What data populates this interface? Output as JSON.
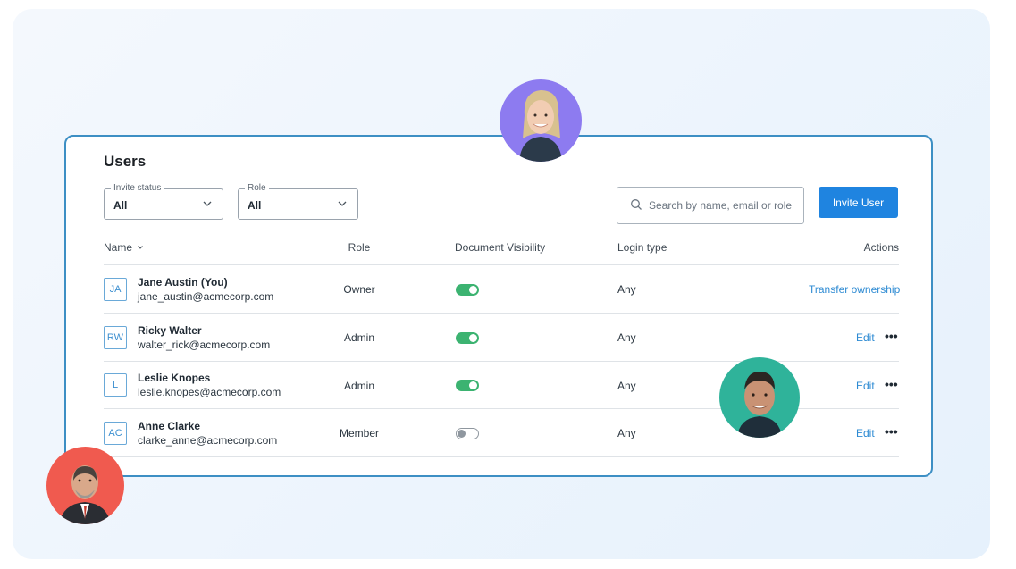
{
  "header": {
    "title": "Users"
  },
  "filters": {
    "invite_status": {
      "label": "Invite status",
      "value": "All"
    },
    "role": {
      "label": "Role",
      "value": "All"
    }
  },
  "search": {
    "placeholder": "Search by name, email or role"
  },
  "invite_button": {
    "label": "Invite User"
  },
  "columns": {
    "name": "Name",
    "role": "Role",
    "visibility": "Document Visibility",
    "login": "Login type",
    "actions": "Actions"
  },
  "users": [
    {
      "initials": "JA",
      "name": "Jane Austin (You)",
      "email": "jane_austin@acmecorp.com",
      "role": "Owner",
      "visibility": true,
      "login": "Any",
      "action": "Transfer ownership"
    },
    {
      "initials": "RW",
      "name": "Ricky Walter",
      "email": "walter_rick@acmecorp.com",
      "role": "Admin",
      "visibility": true,
      "login": "Any",
      "action": "Edit",
      "more": "•••"
    },
    {
      "initials": "L",
      "name": "Leslie Knopes",
      "email": "leslie.knopes@acmecorp.com",
      "role": "Admin",
      "visibility": true,
      "login": "Any",
      "action": "Edit",
      "more": "•••"
    },
    {
      "initials": "AC",
      "name": "Anne Clarke",
      "email": "clarke_anne@acmecorp.com",
      "role": "Member",
      "visibility": false,
      "login": "Any",
      "action": "Edit",
      "more": "•••"
    }
  ],
  "colors": {
    "accent": "#1f84e0",
    "toggle_on": "#3cb371",
    "card_border": "#3d8fc4",
    "photo_top": "#8d7bf0",
    "photo_right": "#2fb39a",
    "photo_left": "#f05a4f"
  }
}
